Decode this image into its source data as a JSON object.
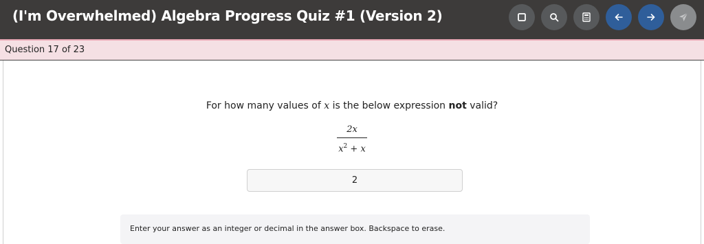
{
  "header": {
    "title": "(I'm Overwhelmed) Algebra Progress Quiz #1 (Version 2)",
    "buttons": [
      {
        "name": "square-icon",
        "color": "#57595b"
      },
      {
        "name": "search-icon",
        "color": "#57595b"
      },
      {
        "name": "calculator-icon",
        "color": "#57595b"
      },
      {
        "name": "arrow-left-icon",
        "color": "#2f5e9a"
      },
      {
        "name": "arrow-right-icon",
        "color": "#2f5e9a"
      },
      {
        "name": "send-icon",
        "color": "#8a8c8e"
      }
    ]
  },
  "progress": {
    "label": "Question 17 of 23"
  },
  "question": {
    "text_before": "For how many values of ",
    "variable": "x",
    "text_middle": " is the below expression ",
    "emphasis": "not",
    "text_after": " valid?",
    "expression": {
      "numerator": "2x",
      "denominator_base": "x",
      "denominator_exponent": "2",
      "denominator_operator": " + ",
      "denominator_term": "x"
    }
  },
  "answer": {
    "value": "2"
  },
  "hint": {
    "text": "Enter your answer as an integer or decimal in the answer box. Backspace to erase."
  }
}
